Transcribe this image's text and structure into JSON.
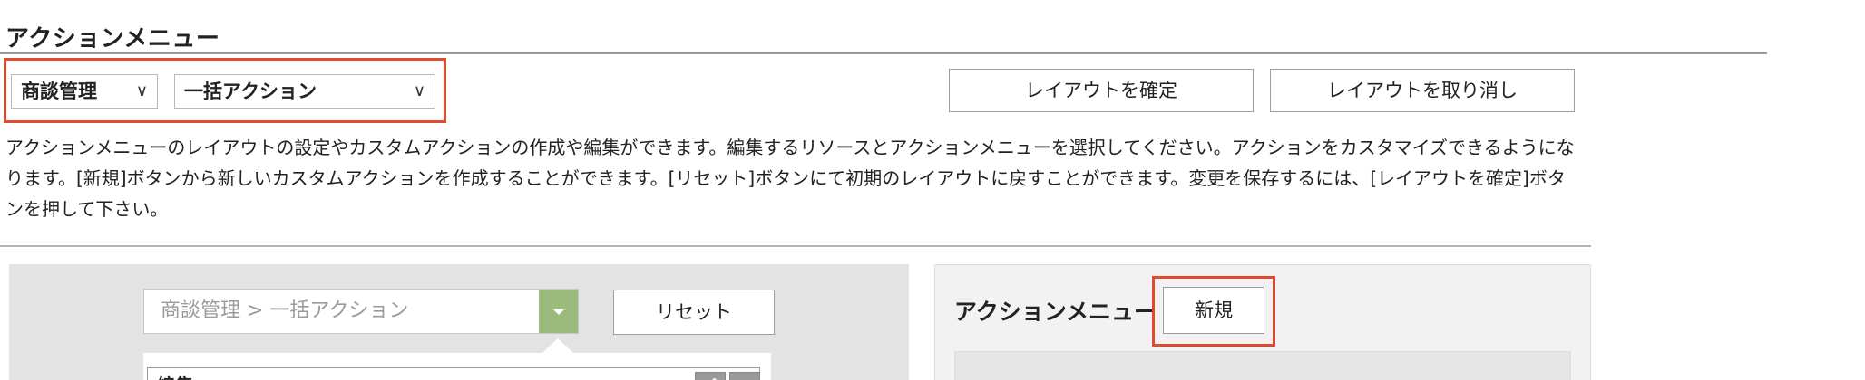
{
  "page": {
    "title": "アクションメニュー",
    "description": "アクションメニューのレイアウトの設定やカスタムアクションの作成や編集ができます。編集するリソースとアクションメニューを選択してください。アクションをカスタマイズできるようになります。[新規]ボタンから新しいカスタムアクションを作成することができます。[リセット]ボタンにて初期のレイアウトに戻すことができます。変更を保存するには、[レイアウトを確定]ボタンを押して下さい。"
  },
  "selectors": {
    "resource": {
      "value": "商談管理"
    },
    "action_menu": {
      "value": "一括アクション"
    }
  },
  "toolbar": {
    "confirm_layout_label": "レイアウトを確定",
    "cancel_layout_label": "レイアウトを取り消し"
  },
  "layout_editor": {
    "resource_path": "商談管理 > 一括アクション",
    "reset_label": "リセット",
    "menu_items": [
      {
        "label": "編集"
      }
    ]
  },
  "action_panel": {
    "title": "アクションメニュー",
    "new_label": "新規"
  },
  "colors": {
    "highlight": "#e04a2f",
    "dropdown_toggle": "#9bbb7d",
    "editor_background": "#e3e3e3",
    "panel_background": "#f2f2f2"
  },
  "icons": {
    "select_chevron": "chevron-down-icon",
    "dropdown_toggle": "triangle-down-icon",
    "edit": "pencil-icon",
    "delete": "delete-icon"
  }
}
